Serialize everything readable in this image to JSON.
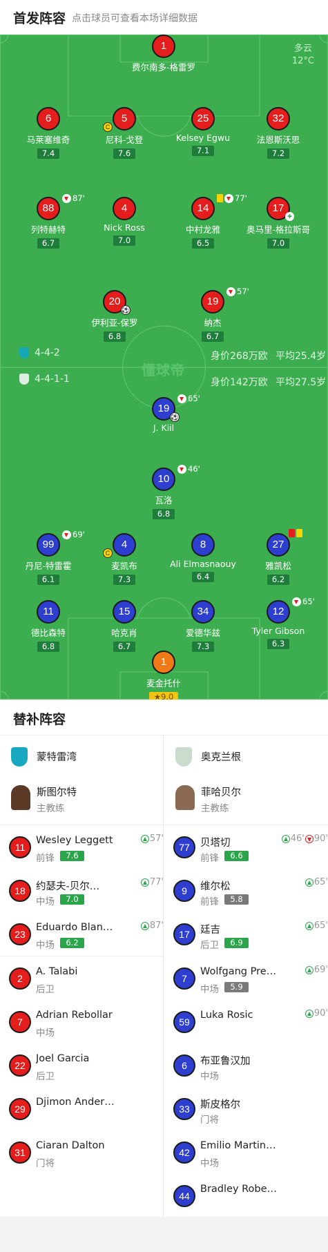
{
  "header": {
    "title": "首发阵容",
    "subtitle": "点击球员可查看本场详细数据"
  },
  "weather": {
    "condition": "多云",
    "temp": "12°C"
  },
  "watermark": "懂球帝",
  "formations": {
    "home": {
      "shape": "4-4-2",
      "value": "身价268万欧",
      "age": "平均25.4岁",
      "color": "#15a7b5"
    },
    "away": {
      "shape": "4-4-1-1",
      "value": "身价142万欧",
      "age": "平均27.5岁",
      "color": "#dfeee2"
    }
  },
  "home_players": [
    {
      "num": "1",
      "name": "费尔南多-格雷罗",
      "rating": "",
      "event": ""
    },
    {
      "num": "6",
      "name": "马莱塞维奇",
      "rating": "7.4",
      "event": ""
    },
    {
      "num": "5",
      "name": "尼科-戈登",
      "rating": "7.6",
      "event": ""
    },
    {
      "num": "25",
      "name": "Kelsey Egwu",
      "rating": "7.1",
      "event": ""
    },
    {
      "num": "32",
      "name": "法恩斯沃思",
      "rating": "7.2",
      "event": ""
    },
    {
      "num": "88",
      "name": "列特赫特",
      "rating": "6.7",
      "event": "87'"
    },
    {
      "num": "4",
      "name": "Nick Ross",
      "rating": "7.0",
      "event": ""
    },
    {
      "num": "14",
      "name": "中村龙雅",
      "rating": "6.5",
      "event": "77'"
    },
    {
      "num": "17",
      "name": "奥马里-格拉斯哥",
      "rating": "7.0",
      "event": ""
    },
    {
      "num": "20",
      "name": "伊利亚-保罗",
      "rating": "6.8",
      "event": ""
    },
    {
      "num": "19",
      "name": "纳杰",
      "rating": "6.7",
      "event": "57'"
    }
  ],
  "away_players": [
    {
      "num": "19",
      "name": "J. Kiil",
      "rating": "",
      "event": "65'"
    },
    {
      "num": "10",
      "name": "瓦洛",
      "rating": "6.8",
      "event": "46'"
    },
    {
      "num": "99",
      "name": "丹尼-特雷霍",
      "rating": "6.1",
      "event": "69'"
    },
    {
      "num": "4",
      "name": "麦凯布",
      "rating": "7.3",
      "event": ""
    },
    {
      "num": "8",
      "name": "Ali Elmasnaouy",
      "rating": "6.4",
      "event": ""
    },
    {
      "num": "27",
      "name": "雅凯松",
      "rating": "6.2",
      "event": ""
    },
    {
      "num": "11",
      "name": "德比森特",
      "rating": "6.8",
      "event": ""
    },
    {
      "num": "15",
      "name": "哈克肖",
      "rating": "6.7",
      "event": ""
    },
    {
      "num": "34",
      "name": "爱德华兹",
      "rating": "7.3",
      "event": ""
    },
    {
      "num": "12",
      "name": "Tyler Gibson",
      "rating": "6.3",
      "event": "65'"
    },
    {
      "num": "1",
      "name": "麦金托什",
      "rating": "9.0",
      "event": ""
    }
  ],
  "subs_title": "替补阵容",
  "home_team": {
    "name": "蒙特雷湾",
    "coach": "斯图尔特",
    "coach_role": "主教练",
    "color": "#18a9c0"
  },
  "away_team": {
    "name": "奥克兰根",
    "coach": "菲哈贝尔",
    "coach_role": "主教练",
    "color": "#c9dccd"
  },
  "home_subs": [
    {
      "num": "11",
      "name": "Wesley Leggett",
      "pos": "前锋",
      "rating": "7.6",
      "time": "57'"
    },
    {
      "num": "18",
      "name": "约瑟夫-贝尔…",
      "pos": "中场",
      "rating": "7.0",
      "time": "77'"
    },
    {
      "num": "23",
      "name": "Eduardo Blan…",
      "pos": "中场",
      "rating": "6.2",
      "time": "87'"
    },
    {
      "num": "2",
      "name": "A. Talabi",
      "pos": "后卫",
      "rating": "",
      "time": ""
    },
    {
      "num": "7",
      "name": "Adrian Rebollar",
      "pos": "中场",
      "rating": "",
      "time": ""
    },
    {
      "num": "22",
      "name": "Joel Garcia",
      "pos": "后卫",
      "rating": "",
      "time": ""
    },
    {
      "num": "29",
      "name": "Djimon Ander…",
      "pos": "",
      "rating": "",
      "time": ""
    },
    {
      "num": "31",
      "name": "Ciaran Dalton",
      "pos": "门将",
      "rating": "",
      "time": ""
    }
  ],
  "away_subs": [
    {
      "num": "77",
      "name": "贝塔切",
      "pos": "前锋",
      "rating": "6.6",
      "time": "46'",
      "time2": "90'"
    },
    {
      "num": "9",
      "name": "维尔松",
      "pos": "前锋",
      "rating": "5.8",
      "time": "65'"
    },
    {
      "num": "17",
      "name": "廷吉",
      "pos": "后卫",
      "rating": "6.9",
      "time": "65'"
    },
    {
      "num": "7",
      "name": "Wolfgang Pre…",
      "pos": "中场",
      "rating": "5.9",
      "time": "69'"
    },
    {
      "num": "59",
      "name": "Luka Rosic",
      "pos": "",
      "rating": "",
      "time": "90'"
    },
    {
      "num": "6",
      "name": "布亚鲁汉加",
      "pos": "中场",
      "rating": "",
      "time": ""
    },
    {
      "num": "33",
      "name": "斯皮格尔",
      "pos": "门将",
      "rating": "",
      "time": ""
    },
    {
      "num": "42",
      "name": "Emilio Martin…",
      "pos": "中场",
      "rating": "",
      "time": ""
    },
    {
      "num": "44",
      "name": "Bradley Robe…",
      "pos": "",
      "rating": "",
      "time": ""
    }
  ],
  "badges": {
    "yellow": "C",
    "star": "★"
  }
}
